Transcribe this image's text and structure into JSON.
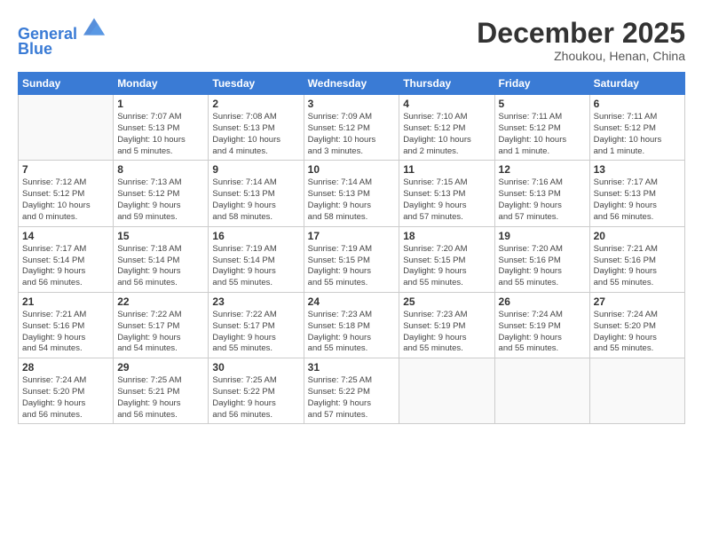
{
  "header": {
    "logo_line1": "General",
    "logo_line2": "Blue",
    "month": "December 2025",
    "location": "Zhoukou, Henan, China"
  },
  "weekdays": [
    "Sunday",
    "Monday",
    "Tuesday",
    "Wednesday",
    "Thursday",
    "Friday",
    "Saturday"
  ],
  "weeks": [
    [
      {
        "day": "",
        "info": ""
      },
      {
        "day": "1",
        "info": "Sunrise: 7:07 AM\nSunset: 5:13 PM\nDaylight: 10 hours\nand 5 minutes."
      },
      {
        "day": "2",
        "info": "Sunrise: 7:08 AM\nSunset: 5:13 PM\nDaylight: 10 hours\nand 4 minutes."
      },
      {
        "day": "3",
        "info": "Sunrise: 7:09 AM\nSunset: 5:12 PM\nDaylight: 10 hours\nand 3 minutes."
      },
      {
        "day": "4",
        "info": "Sunrise: 7:10 AM\nSunset: 5:12 PM\nDaylight: 10 hours\nand 2 minutes."
      },
      {
        "day": "5",
        "info": "Sunrise: 7:11 AM\nSunset: 5:12 PM\nDaylight: 10 hours\nand 1 minute."
      },
      {
        "day": "6",
        "info": "Sunrise: 7:11 AM\nSunset: 5:12 PM\nDaylight: 10 hours\nand 1 minute."
      }
    ],
    [
      {
        "day": "7",
        "info": "Sunrise: 7:12 AM\nSunset: 5:12 PM\nDaylight: 10 hours\nand 0 minutes."
      },
      {
        "day": "8",
        "info": "Sunrise: 7:13 AM\nSunset: 5:12 PM\nDaylight: 9 hours\nand 59 minutes."
      },
      {
        "day": "9",
        "info": "Sunrise: 7:14 AM\nSunset: 5:13 PM\nDaylight: 9 hours\nand 58 minutes."
      },
      {
        "day": "10",
        "info": "Sunrise: 7:14 AM\nSunset: 5:13 PM\nDaylight: 9 hours\nand 58 minutes."
      },
      {
        "day": "11",
        "info": "Sunrise: 7:15 AM\nSunset: 5:13 PM\nDaylight: 9 hours\nand 57 minutes."
      },
      {
        "day": "12",
        "info": "Sunrise: 7:16 AM\nSunset: 5:13 PM\nDaylight: 9 hours\nand 57 minutes."
      },
      {
        "day": "13",
        "info": "Sunrise: 7:17 AM\nSunset: 5:13 PM\nDaylight: 9 hours\nand 56 minutes."
      }
    ],
    [
      {
        "day": "14",
        "info": "Sunrise: 7:17 AM\nSunset: 5:14 PM\nDaylight: 9 hours\nand 56 minutes."
      },
      {
        "day": "15",
        "info": "Sunrise: 7:18 AM\nSunset: 5:14 PM\nDaylight: 9 hours\nand 56 minutes."
      },
      {
        "day": "16",
        "info": "Sunrise: 7:19 AM\nSunset: 5:14 PM\nDaylight: 9 hours\nand 55 minutes."
      },
      {
        "day": "17",
        "info": "Sunrise: 7:19 AM\nSunset: 5:15 PM\nDaylight: 9 hours\nand 55 minutes."
      },
      {
        "day": "18",
        "info": "Sunrise: 7:20 AM\nSunset: 5:15 PM\nDaylight: 9 hours\nand 55 minutes."
      },
      {
        "day": "19",
        "info": "Sunrise: 7:20 AM\nSunset: 5:16 PM\nDaylight: 9 hours\nand 55 minutes."
      },
      {
        "day": "20",
        "info": "Sunrise: 7:21 AM\nSunset: 5:16 PM\nDaylight: 9 hours\nand 55 minutes."
      }
    ],
    [
      {
        "day": "21",
        "info": "Sunrise: 7:21 AM\nSunset: 5:16 PM\nDaylight: 9 hours\nand 54 minutes."
      },
      {
        "day": "22",
        "info": "Sunrise: 7:22 AM\nSunset: 5:17 PM\nDaylight: 9 hours\nand 54 minutes."
      },
      {
        "day": "23",
        "info": "Sunrise: 7:22 AM\nSunset: 5:17 PM\nDaylight: 9 hours\nand 55 minutes."
      },
      {
        "day": "24",
        "info": "Sunrise: 7:23 AM\nSunset: 5:18 PM\nDaylight: 9 hours\nand 55 minutes."
      },
      {
        "day": "25",
        "info": "Sunrise: 7:23 AM\nSunset: 5:19 PM\nDaylight: 9 hours\nand 55 minutes."
      },
      {
        "day": "26",
        "info": "Sunrise: 7:24 AM\nSunset: 5:19 PM\nDaylight: 9 hours\nand 55 minutes."
      },
      {
        "day": "27",
        "info": "Sunrise: 7:24 AM\nSunset: 5:20 PM\nDaylight: 9 hours\nand 55 minutes."
      }
    ],
    [
      {
        "day": "28",
        "info": "Sunrise: 7:24 AM\nSunset: 5:20 PM\nDaylight: 9 hours\nand 56 minutes."
      },
      {
        "day": "29",
        "info": "Sunrise: 7:25 AM\nSunset: 5:21 PM\nDaylight: 9 hours\nand 56 minutes."
      },
      {
        "day": "30",
        "info": "Sunrise: 7:25 AM\nSunset: 5:22 PM\nDaylight: 9 hours\nand 56 minutes."
      },
      {
        "day": "31",
        "info": "Sunrise: 7:25 AM\nSunset: 5:22 PM\nDaylight: 9 hours\nand 57 minutes."
      },
      {
        "day": "",
        "info": ""
      },
      {
        "day": "",
        "info": ""
      },
      {
        "day": "",
        "info": ""
      }
    ]
  ]
}
